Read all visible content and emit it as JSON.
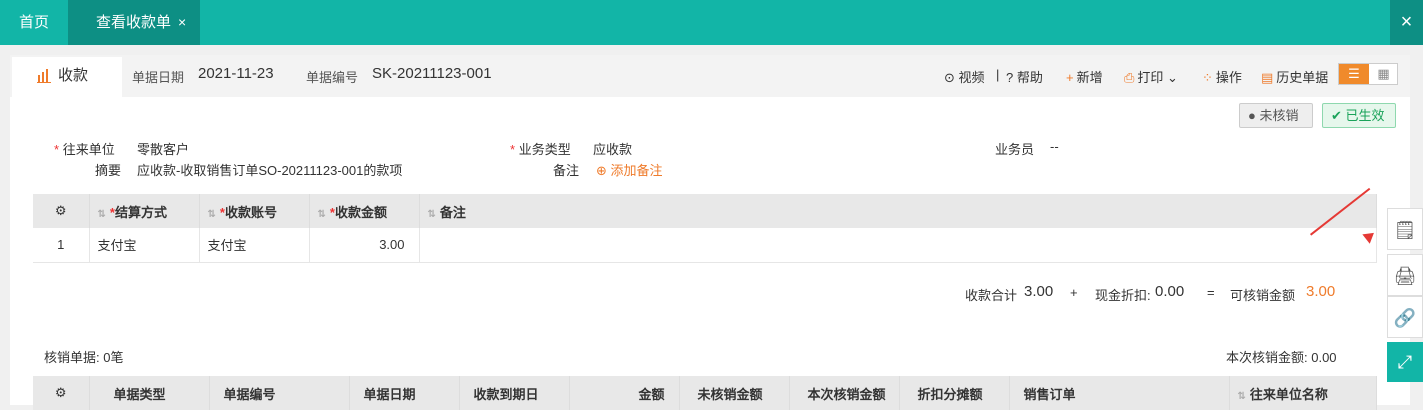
{
  "tabs": {
    "home": "首页",
    "active": "查看收款单",
    "active_close": "×"
  },
  "top_close": "×",
  "doc": {
    "tab_label": "收款",
    "date_label": "单据日期",
    "date_value": "2021-11-23",
    "no_label": "单据编号",
    "no_value": "SK-20211123-001"
  },
  "toolbar": {
    "video": "视频",
    "help": "帮助",
    "new": "新增",
    "print": "打印",
    "operate": "操作",
    "history": "历史单据"
  },
  "status": {
    "unverified": "未核销",
    "active": "已生效"
  },
  "form": {
    "partner_label": "往来单位",
    "partner_value": "零散客户",
    "biz_type_label": "业务类型",
    "biz_type_value": "应收款",
    "salesman_label": "业务员",
    "salesman_value": "--",
    "summary_label": "摘要",
    "summary_value": "应收款-收取销售订单SO-20211123-001的款项",
    "remark_label": "备注",
    "add_remark": "添加备注"
  },
  "payments": {
    "headers": [
      "结算方式",
      "收款账号",
      "收款金额",
      "备注"
    ],
    "rows": [
      {
        "index": "1",
        "method": "支付宝",
        "account": "支付宝",
        "amount": "3.00",
        "note": ""
      }
    ]
  },
  "totals": {
    "receipt_label": "收款合计",
    "receipt_value": "3.00",
    "plus": "+",
    "discount_label": "现金折扣:",
    "discount_value": "0.00",
    "equals": "=",
    "writeoff_label": "可核销金额",
    "writeoff_value": "3.00"
  },
  "writeoff": {
    "count_text": "核销单据: 0笔",
    "current_text": "本次核销金额: 0.00",
    "headers": [
      "单据类型",
      "单据编号",
      "单据日期",
      "收款到期日",
      "金额",
      "未核销金额",
      "本次核销金额",
      "折扣分摊额",
      "销售订单",
      "往来单位名称"
    ]
  },
  "colors": {
    "brand": "#12b5a7",
    "accent": "#ef7b2b",
    "success": "#1aa35a"
  }
}
